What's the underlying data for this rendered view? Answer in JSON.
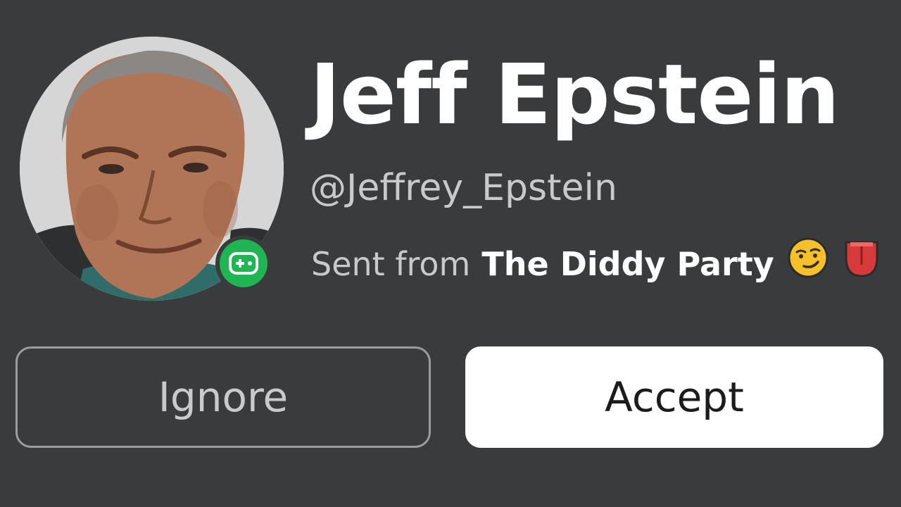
{
  "profile": {
    "display_name": "Jeff Epstein",
    "username": "@Jeffrey_Epstein",
    "sent_from_prefix": "Sent from",
    "sent_from_place": "The Diddy Party",
    "presence_status": "in-game",
    "emoji": [
      "smirking-face",
      "tongue"
    ]
  },
  "actions": {
    "ignore_label": "Ignore",
    "accept_label": "Accept"
  },
  "colors": {
    "background": "#393b3d",
    "presence_green": "#1fb552",
    "accept_bg": "#ffffff"
  }
}
